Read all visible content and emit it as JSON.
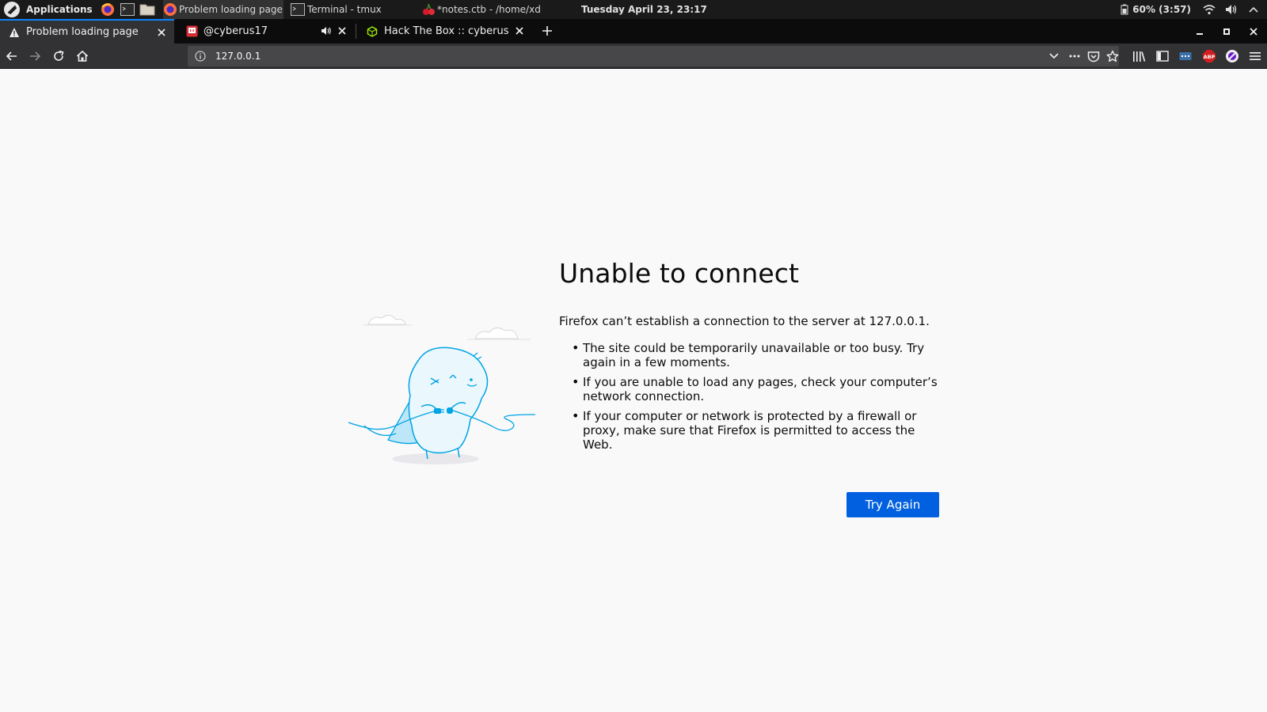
{
  "system_panel": {
    "apps_label": "Applications",
    "tasks": [
      {
        "label": "Problem loading page...",
        "icon": "firefox-icon",
        "active": true
      },
      {
        "label": "Terminal - tmux",
        "icon": "terminal-icon",
        "active": false
      },
      {
        "label": "*notes.ctb - /home/xde...",
        "icon": "cherrytree-icon",
        "active": false
      }
    ],
    "clock": "Tuesday April 23, 23:17",
    "battery": "60% (3:57)"
  },
  "tabs": [
    {
      "title": "Problem loading page",
      "icon": "warning-icon",
      "selected": true
    },
    {
      "title": "@cyberus17",
      "icon": "twitch-icon",
      "selected": false,
      "audio": true
    },
    {
      "title": "Hack The Box :: cyberus",
      "icon": "htb-icon",
      "selected": false
    }
  ],
  "navbar": {
    "url": "127.0.0.1"
  },
  "error_page": {
    "title": "Unable to connect",
    "description": "Firefox can’t establish a connection to the server at 127.0.0.1.",
    "bullets": [
      "The site could be temporarily unavailable or too busy. Try again in a few moments.",
      "If you are unable to load any pages, check your computer’s network connection.",
      "If your computer or network is protected by a firewall or proxy, make sure that Firefox is permitted to access the Web."
    ],
    "try_again_label": "Try Again"
  },
  "colors": {
    "accent": "#0a84ff",
    "button": "#0060df",
    "page_bg": "#f9f9fa",
    "illustration": "#00a4e4"
  }
}
